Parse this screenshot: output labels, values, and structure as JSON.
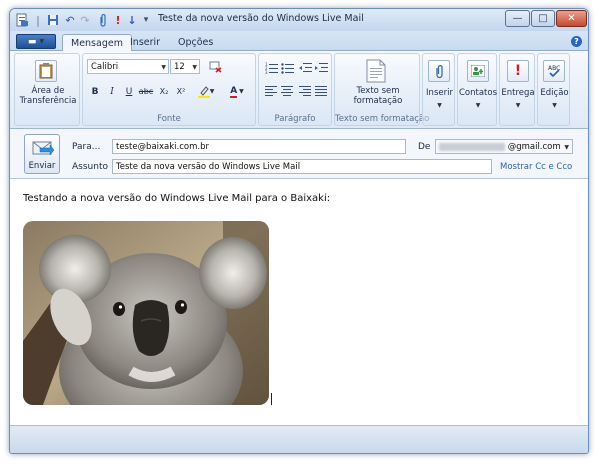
{
  "window": {
    "title": "Teste da nova versão do Windows Live Mail",
    "minimize": "—",
    "maximize": "□",
    "close": "✕"
  },
  "tabs": [
    {
      "label": "Mensagem"
    },
    {
      "label": "Inserir"
    },
    {
      "label": "Opções"
    }
  ],
  "ribbon": {
    "clipboard": {
      "label_line1": "Área de",
      "label_line2": "Transferência"
    },
    "font": {
      "family": "Calibri",
      "size": "12",
      "group_label": "Fonte"
    },
    "paragraph": {
      "group_label": "Parágrafo"
    },
    "plain_text": {
      "label_line1": "Texto sem",
      "label_line2": "formatação",
      "group_label": "Texto sem formatação"
    },
    "insert": {
      "label": "Inserir"
    },
    "contacts": {
      "label": "Contatos"
    },
    "delivery": {
      "label": "Entrega"
    },
    "editing": {
      "label": "Edição"
    }
  },
  "compose": {
    "send_label": "Enviar",
    "to_label": "Para...",
    "to_value": "teste@baixaki.com.br",
    "subject_label": "Assunto",
    "subject_value": "Teste da nova versão do Windows Live Mail",
    "from_label": "De",
    "from_value": "@gmail.com",
    "cc_link": "Mostrar Cc e Cco"
  },
  "body": {
    "text": "Testando a nova versão do Windows Live Mail para o Baixaki:"
  },
  "colors": {
    "accent": "#2b62b8",
    "highlight_yellow": "#ffe600",
    "font_red": "#d21f1f"
  }
}
